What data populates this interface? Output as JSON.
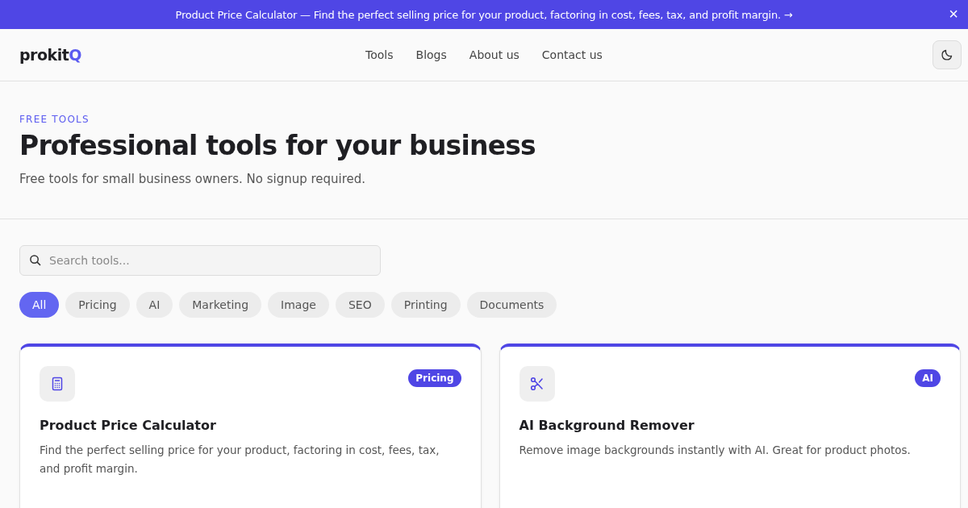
{
  "banner": {
    "text": "Product Price Calculator — Find the perfect selling price for your product, factoring in cost, fees, tax, and profit margin. →",
    "close": "×"
  },
  "header": {
    "logo": "prokit",
    "logo_accent": "Q",
    "nav": [
      "Tools",
      "Blogs",
      "About us",
      "Contact us"
    ]
  },
  "hero": {
    "eyebrow": "FREE TOOLS",
    "title": "Professional tools for your business",
    "subtitle": "Free tools for small business owners. No signup required."
  },
  "search": {
    "placeholder": "Search tools..."
  },
  "filters": [
    {
      "label": "All",
      "selected": true
    },
    {
      "label": "Pricing",
      "selected": false
    },
    {
      "label": "AI",
      "selected": false
    },
    {
      "label": "Marketing",
      "selected": false
    },
    {
      "label": "Image",
      "selected": false
    },
    {
      "label": "SEO",
      "selected": false
    },
    {
      "label": "Printing",
      "selected": false
    },
    {
      "label": "Documents",
      "selected": false
    }
  ],
  "tools": [
    {
      "kind": "calculator",
      "tag": "Pricing",
      "title": "Product Price Calculator",
      "description": "Find the perfect selling price for your product, factoring in cost, fees, tax, and profit margin."
    },
    {
      "kind": "scissors",
      "tag": "AI",
      "title": "AI Background Remover",
      "description": "Remove image backgrounds instantly with AI. Great for product photos."
    }
  ]
}
